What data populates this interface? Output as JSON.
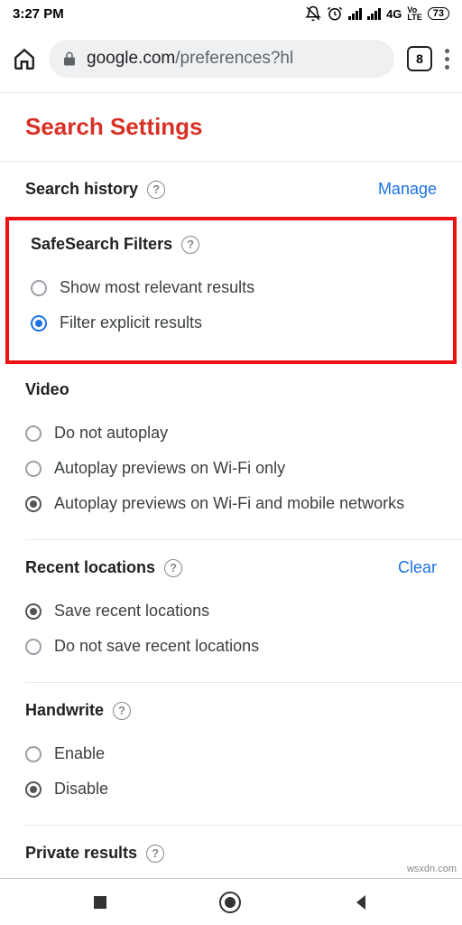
{
  "status": {
    "time": "3:27 PM",
    "net": "4G",
    "volte": "Vo\nLTE",
    "battery": "73"
  },
  "browser": {
    "host": "google.com",
    "path": "/preferences?hl",
    "tab_count": "8"
  },
  "page_title": "Search Settings",
  "search_history": {
    "label": "Search history",
    "action": "Manage"
  },
  "safesearch": {
    "label": "SafeSearch Filters",
    "options": [
      "Show most relevant results",
      "Filter explicit results"
    ]
  },
  "video": {
    "label": "Video",
    "options": [
      "Do not autoplay",
      "Autoplay previews on Wi-Fi only",
      "Autoplay previews on Wi-Fi and mobile networks"
    ]
  },
  "recent": {
    "label": "Recent locations",
    "action": "Clear",
    "options": [
      "Save recent locations",
      "Do not save recent locations"
    ]
  },
  "handwrite": {
    "label": "Handwrite",
    "options": [
      "Enable",
      "Disable"
    ]
  },
  "private": {
    "label": "Private results"
  },
  "watermark": "wsxdn.com"
}
